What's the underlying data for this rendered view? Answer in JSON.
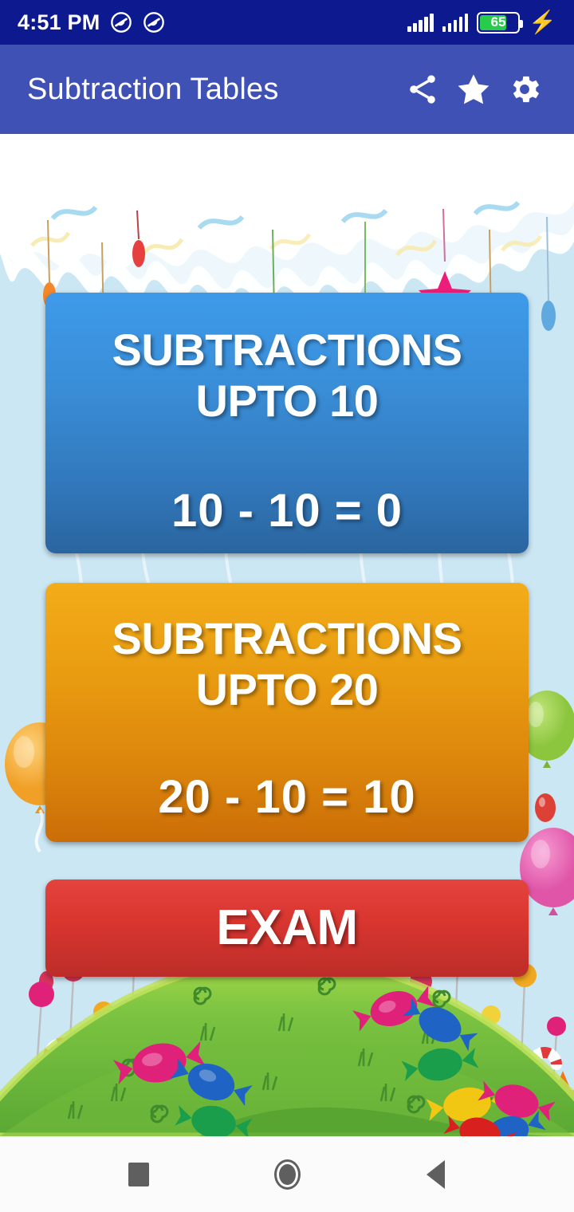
{
  "status_bar": {
    "time": "4:51 PM",
    "icons": [
      "dnd-icon",
      "dnd-icon",
      "signal-icon",
      "signal-icon"
    ],
    "battery_percent": "65",
    "battery_level": 65,
    "charging": true,
    "background_color": "#0d1a8f"
  },
  "app_bar": {
    "title": "Subtraction Tables",
    "background_color": "#3f51b5",
    "actions": [
      {
        "name": "share-icon",
        "label": "Share"
      },
      {
        "name": "star-icon",
        "label": "Rate"
      },
      {
        "name": "gear-icon",
        "label": "Settings"
      }
    ]
  },
  "main": {
    "background": "candyland",
    "cards": [
      {
        "id": "upto-10",
        "title": "SUBTRACTIONS\nUPTO 10",
        "title_line1": "SUBTRACTIONS",
        "title_line2": "UPTO 10",
        "equation": "10 - 10 = 0",
        "color_top": "#3e9ae9",
        "color_bottom": "#2a659f"
      },
      {
        "id": "upto-20",
        "title": "SUBTRACTIONS\nUPTO 20",
        "title_line1": "SUBTRACTIONS",
        "title_line2": "UPTO 20",
        "equation": "20 - 10 = 10",
        "color_top": "#f3ac1a",
        "color_bottom": "#cb6d07"
      },
      {
        "id": "exam",
        "title": "EXAM",
        "equation": "",
        "color_top": "#e5433e",
        "color_bottom": "#bc2d29"
      }
    ]
  },
  "nav_bar": {
    "buttons": [
      {
        "name": "recents-button",
        "label": "Recents"
      },
      {
        "name": "home-button",
        "label": "Home"
      },
      {
        "name": "back-button",
        "label": "Back"
      }
    ],
    "background_color": "#fbfbfb"
  }
}
